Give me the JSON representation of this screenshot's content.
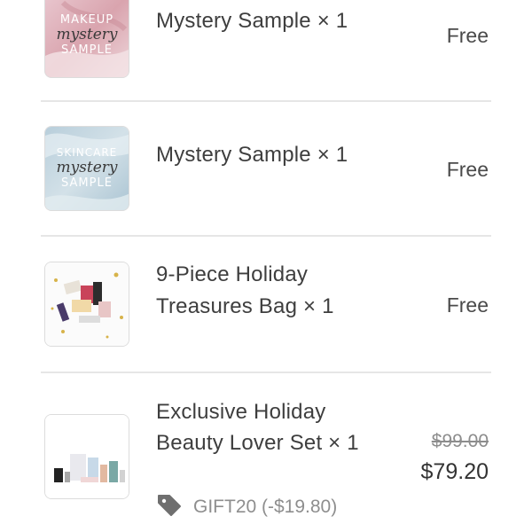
{
  "items": [
    {
      "thumb": {
        "line1": "MAKEUP",
        "line2": "mystery",
        "line3": "SAMPLE"
      },
      "title": "Mystery Sample × 1",
      "price": "Free"
    },
    {
      "thumb": {
        "line1": "SKINCARE",
        "line2": "mystery",
        "line3": "SAMPLE"
      },
      "title": "Mystery Sample × 1",
      "price": "Free"
    },
    {
      "title_line1": "9-Piece Holiday",
      "title_line2": "Treasures Bag × 1",
      "price": "Free"
    },
    {
      "title_line1": "Exclusive Holiday",
      "title_line2": "Beauty Lover Set × 1",
      "original_price": "$99.00",
      "price": "$79.20",
      "promo_code": "GIFT20 (-$19.80)",
      "promo_icon": "tag-icon"
    }
  ]
}
